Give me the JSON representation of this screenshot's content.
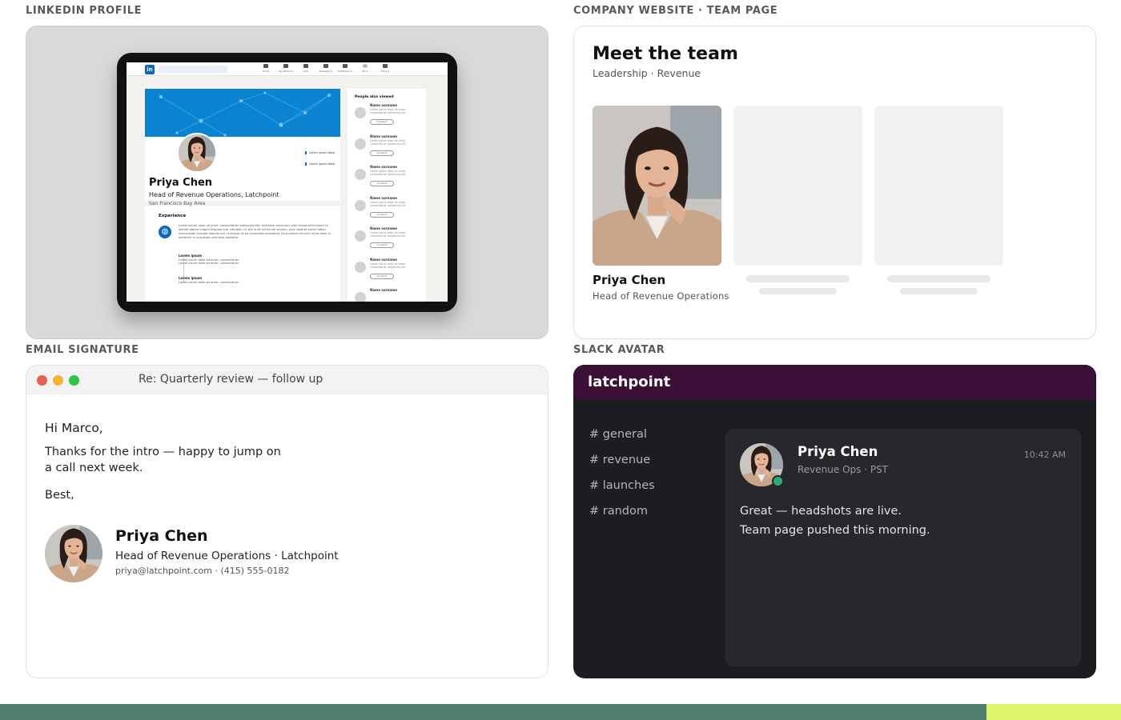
{
  "labels": {
    "linkedin": "LINKEDIN PROFILE",
    "website": "COMPANY WEBSITE · TEAM PAGE",
    "email": "EMAIL SIGNATURE",
    "slack": "SLACK AVATAR"
  },
  "linkedin": {
    "logo": "in",
    "nav": [
      "Home",
      "My Network",
      "Jobs",
      "Messaging",
      "Notifications",
      "Me ▾",
      "Work ▾"
    ],
    "profile": {
      "name": "Priya Chen",
      "headline": "Head of Revenue Operations, Latchpoint",
      "location": "San Francisco Bay Area",
      "buttons": [
        "+ Follow",
        "Message",
        "More"
      ],
      "side_items": [
        "Lorem ipsum dolor",
        "Lorem ipsum dolor"
      ]
    },
    "experience": {
      "title": "Experience",
      "body": "Lorem ipsum dolor sit amet, consectetuer adipiscing elit, sed diam nonummy nibh euismod tincidunt ut laoreet dolore magna aliquam erat volutpat. Ut wisi enim ad minim veniam, quis nostrud exerci tation ullamcorper suscipit lobortis nisl ut aliquip ex ea commodo consequat. Duis autem vel eum iriure dolor in hendrerit in vulputate velit esse molestie.",
      "entries": [
        {
          "title": "Lorem ipsum",
          "lines": [
            "Lorem ipsum dolor sit amet, consectetuer",
            "Lorem ipsum dolor sit amet, consectetuer"
          ]
        },
        {
          "title": "Lorem ipsum",
          "lines": [
            "Lorem ipsum dolor sit amet, consectetuer"
          ]
        }
      ]
    },
    "people_also_viewed": {
      "title": "People also viewed",
      "item_name": "Name surname",
      "item_text": "Lorem ipsum dolor sit amet, consectetuer adipiscing elit",
      "button": "Connect"
    }
  },
  "team": {
    "title": "Meet the team",
    "subtitle": "Leadership · Revenue",
    "member_name": "Priya Chen",
    "member_role": "Head of Revenue Operations"
  },
  "email": {
    "subject": "Re: Quarterly review — follow up",
    "greeting": "Hi Marco,",
    "body_line1": "Thanks for the intro — happy to jump on",
    "body_line2": "a call next week.",
    "closing": "Best,",
    "sig_name": "Priya Chen",
    "sig_role": "Head of Revenue Operations · Latchpoint",
    "sig_contact": "priya@latchpoint.com · (415) 555-0182"
  },
  "slack": {
    "workspace": "latchpoint",
    "channels": [
      "# general",
      "# revenue",
      "# launches",
      "# random"
    ],
    "message": {
      "name": "Priya Chen",
      "status": "Revenue Ops · PST",
      "time": "10:42 AM",
      "line1": "Great — headshots are live.",
      "line2": "Team page pushed this morning."
    }
  },
  "colors": {
    "linkedin_blue": "#0a66c2",
    "slack_aubergine": "#3b0f36",
    "presence_green": "#2bac76",
    "footer_green": "#507f6d",
    "footer_accent": "#e0f56a"
  }
}
